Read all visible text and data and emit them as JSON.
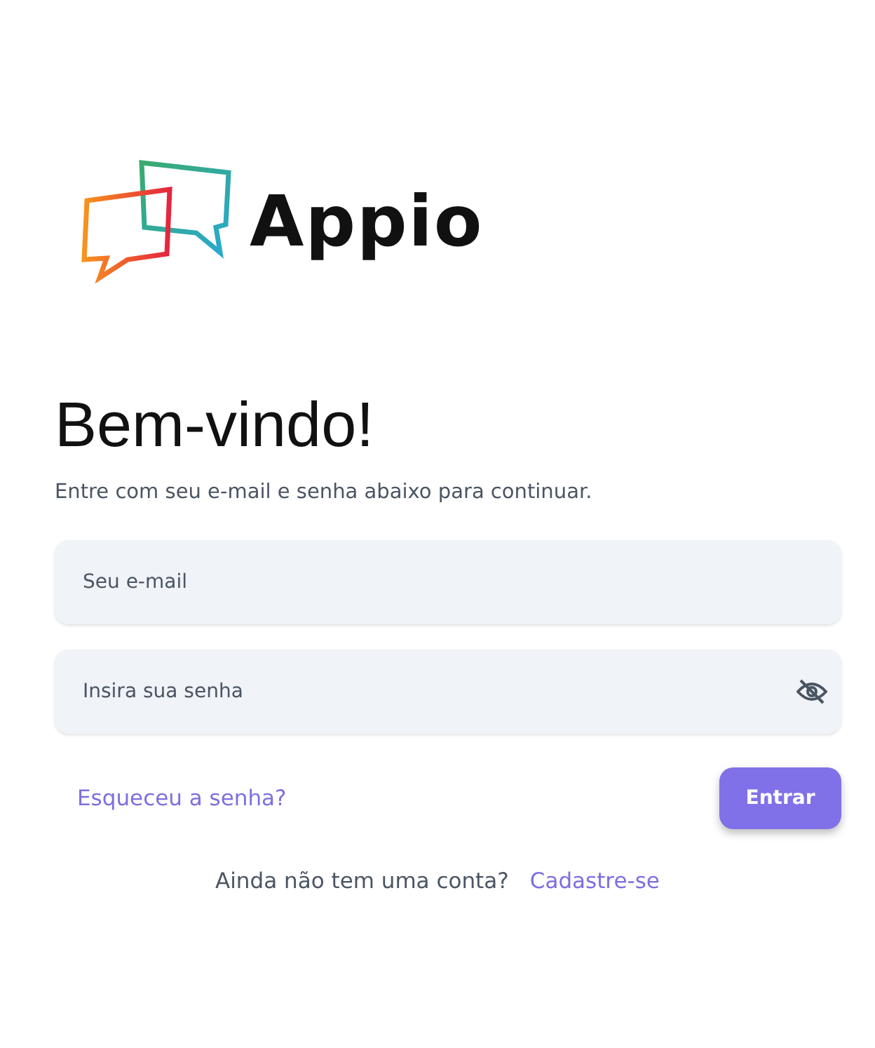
{
  "logo": {
    "text": "Appio"
  },
  "heading": "Bem-vindo!",
  "subtitle": "Entre com seu e-mail e senha abaixo para continuar.",
  "fields": [
    {
      "kind": "email",
      "placeholder": "Seu e-mail"
    },
    {
      "kind": "password",
      "placeholder": "Insira sua senha",
      "visible": false
    }
  ],
  "forgot_link": "Esqueceu a senha?",
  "submit_button": "Entrar",
  "signup": {
    "prompt": "Ainda não tem uma conta?",
    "link": "Cadastre-se"
  }
}
